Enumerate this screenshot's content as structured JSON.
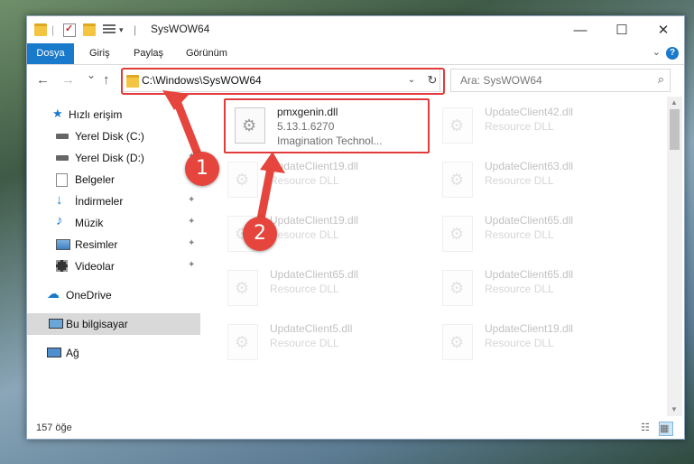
{
  "window": {
    "title": "SysWOW64",
    "minimize_icon": "—",
    "maximize_icon": "☐",
    "close_icon": "✕"
  },
  "ribbon": {
    "tabs": [
      {
        "label": "Dosya",
        "active": true
      },
      {
        "label": "Giriş",
        "active": false
      },
      {
        "label": "Paylaş",
        "active": false
      },
      {
        "label": "Görünüm",
        "active": false
      }
    ],
    "help_icon": "?"
  },
  "nav": {
    "address": "C:\\Windows\\SysWOW64",
    "search_placeholder": "Ara: SysWOW64",
    "back_icon": "←",
    "forward_icon": "→",
    "recent_icon": "⌄",
    "up_icon": "↑",
    "refresh_icon": "↻",
    "search_icon": "⌕"
  },
  "sidebar": {
    "items": [
      {
        "label": "Hızlı erişim",
        "icon": "star-icon",
        "pinned": false
      },
      {
        "label": "Yerel Disk (C:)",
        "icon": "drive-icon",
        "pinned": true
      },
      {
        "label": "Yerel Disk (D:)",
        "icon": "drive-icon",
        "pinned": true
      },
      {
        "label": "Belgeler",
        "icon": "documents-icon",
        "pinned": true
      },
      {
        "label": "İndirmeler",
        "icon": "download-icon",
        "pinned": true
      },
      {
        "label": "Müzik",
        "icon": "music-icon",
        "pinned": true
      },
      {
        "label": "Resimler",
        "icon": "pictures-icon",
        "pinned": true
      },
      {
        "label": "Videolar",
        "icon": "video-icon",
        "pinned": true
      },
      {
        "label": "OneDrive",
        "icon": "cloud-icon",
        "pinned": false
      },
      {
        "label": "Bu bilgisayar",
        "icon": "computer-icon",
        "pinned": false,
        "selected": true
      },
      {
        "label": "Ağ",
        "icon": "network-icon",
        "pinned": false
      }
    ],
    "pin_glyph": "📌"
  },
  "files": [
    {
      "name": "pmxgenin.dll",
      "line2": "5.13.1.6270",
      "line3": "Imagination Technol...",
      "highlighted": true
    },
    {
      "name": "UpdateClient42.dll",
      "line2": "Resource DLL",
      "line3": ""
    },
    {
      "name": "UpdateClient19.dll",
      "line2": "Resource DLL",
      "line3": ""
    },
    {
      "name": "UpdateClient63.dll",
      "line2": "Resource DLL",
      "line3": ""
    },
    {
      "name": "UpdateClient19.dll",
      "line2": "Resource DLL",
      "line3": ""
    },
    {
      "name": "UpdateClient65.dll",
      "line2": "Resource DLL",
      "line3": ""
    },
    {
      "name": "UpdateClient65.dll",
      "line2": "Resource DLL",
      "line3": ""
    },
    {
      "name": "UpdateClient65.dll",
      "line2": "Resource DLL",
      "line3": ""
    },
    {
      "name": "UpdateClient5.dll",
      "line2": "Resource DLL",
      "line3": ""
    },
    {
      "name": "UpdateClient19.dll",
      "line2": "Resource DLL",
      "line3": ""
    }
  ],
  "status": {
    "count": "157 öğe"
  },
  "annotations": [
    {
      "number": "1"
    },
    {
      "number": "2"
    }
  ],
  "colors": {
    "accent": "#1979ca",
    "callout": "#e5453c",
    "highlight_border": "#e23b3b"
  }
}
